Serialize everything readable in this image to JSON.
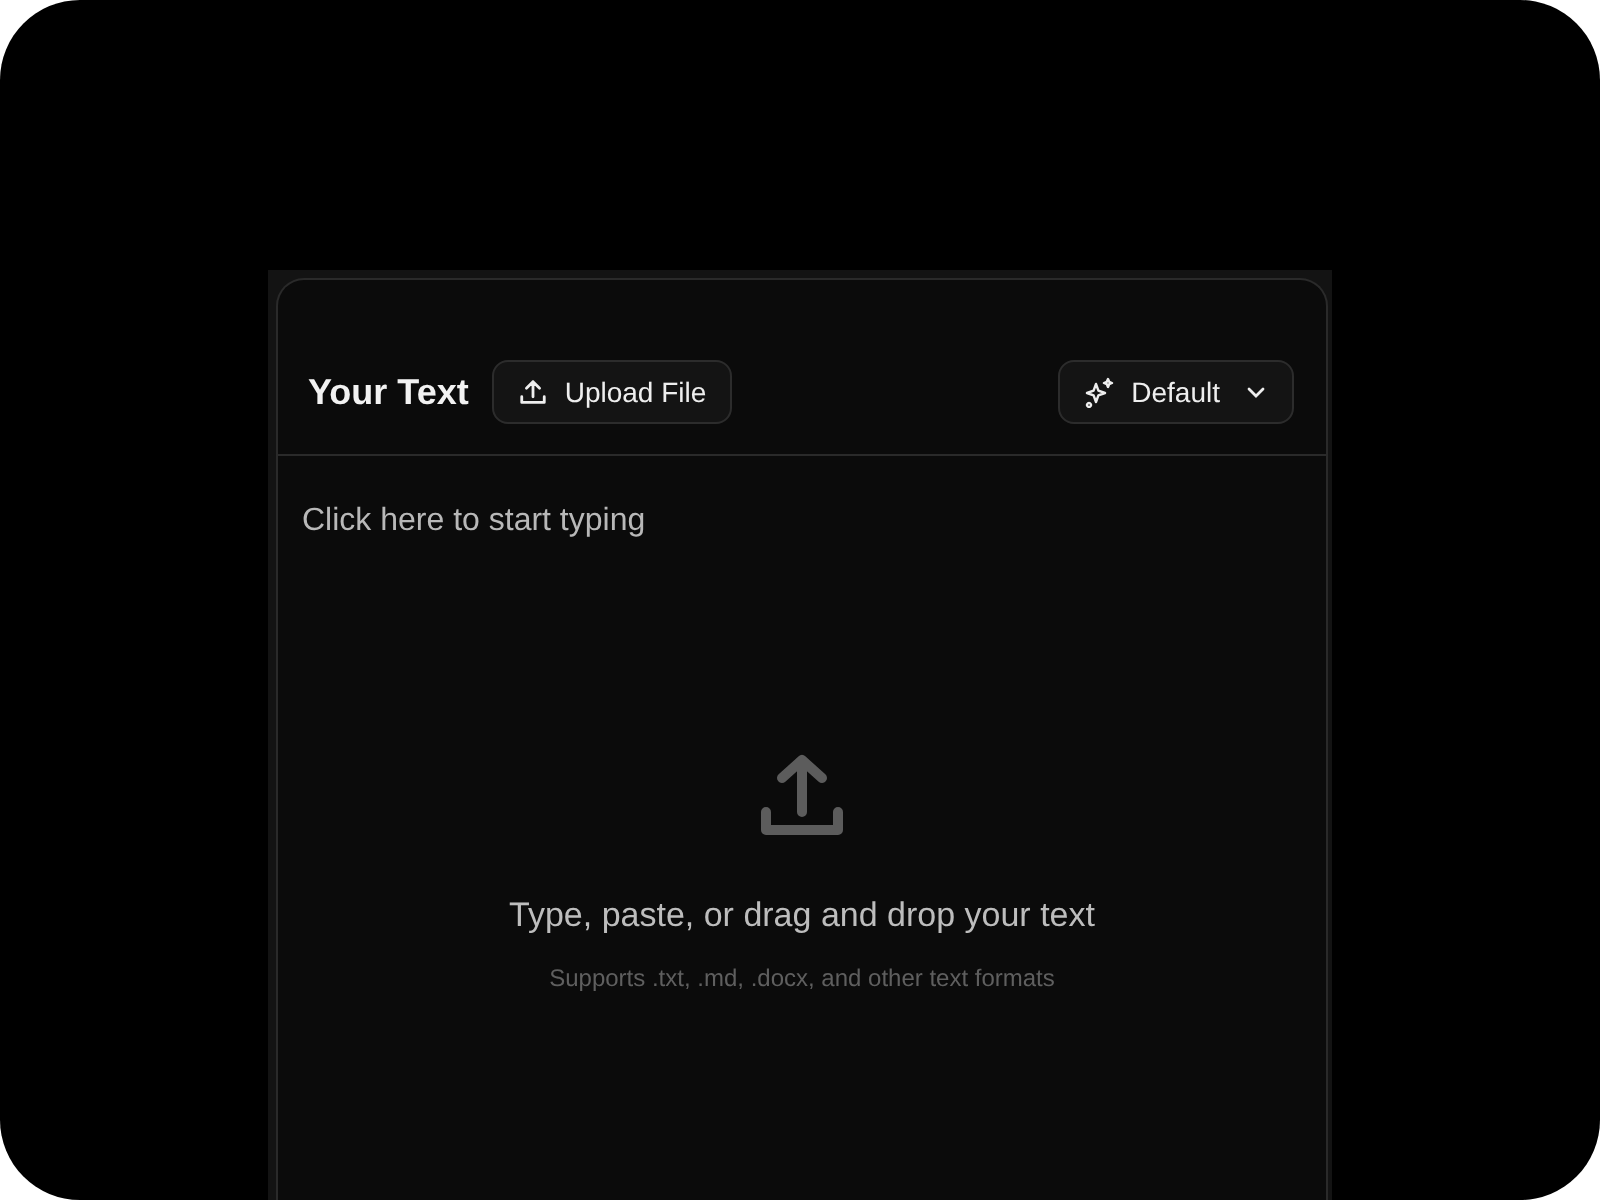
{
  "header": {
    "title": "Your Text",
    "upload_button": "Upload File",
    "style_dropdown": "Default"
  },
  "editor": {
    "placeholder": "Click here to start typing"
  },
  "drop_zone": {
    "message": "Type, paste, or drag and drop your text",
    "hint": "Supports .txt, .md, .docx, and other text formats"
  }
}
